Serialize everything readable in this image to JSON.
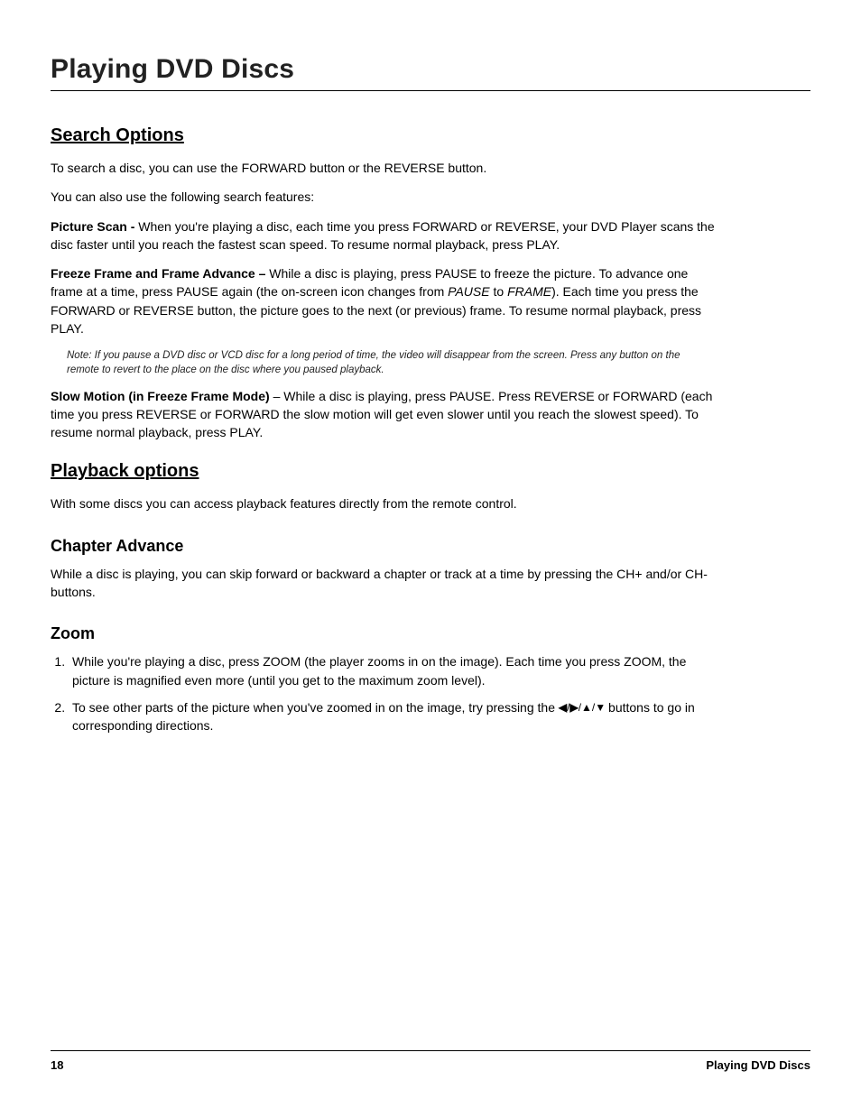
{
  "chapter": {
    "title": "Playing DVD Discs"
  },
  "sections": {
    "search": {
      "heading": "Search Options",
      "intro1": "To search a disc, you can use the FORWARD button or the REVERSE button.",
      "intro2": "You can also use the following search features:",
      "pictureScan": {
        "label": "Picture Scan -",
        "text": " When you're playing a disc, each time you press FORWARD or REVERSE, your DVD Player scans the disc faster until you reach the fastest scan speed. To resume normal playback, press PLAY."
      },
      "freezeFrame": {
        "label": "Freeze Frame and Frame Advance –",
        "pre": " While a disc is playing, press PAUSE to freeze the picture. To advance one frame at a time, press PAUSE again (the on-screen icon changes from ",
        "pauseWord": "PAUSE",
        "mid": " to ",
        "frameWord": "FRAME",
        "post": "). Each time you press the FORWARD or REVERSE button, the picture goes to the next (or previous) frame. To resume normal playback, press PLAY."
      },
      "note": "Note: If you pause a DVD disc or VCD disc for a long period of time, the video will disappear from the screen. Press any button on the remote to revert to the place on the disc where you paused playback.",
      "slowMotion": {
        "label": "Slow Motion (in Freeze Frame Mode)",
        "text": " – While a disc is playing, press PAUSE. Press REVERSE or FORWARD (each time you press REVERSE or FORWARD the slow motion will get even slower until you reach the slowest speed). To resume normal playback, press PLAY."
      }
    },
    "playback": {
      "heading": "Playback options",
      "text": "With some discs you can access playback features directly from the remote control."
    },
    "chapterAdvance": {
      "heading": "Chapter Advance",
      "text": "While a disc is playing, you can skip forward or backward a chapter or track at a time by pressing the CH+ and/or CH- buttons."
    },
    "zoom": {
      "heading": "Zoom",
      "step1": "While you're playing a disc, press ZOOM (the player zooms in on the image). Each time you press ZOOM, the picture is magnified even more (until you get to the maximum zoom level).",
      "step2_pre": "To see other parts of the picture when you've zoomed in on the image, try pressing the ",
      "step2_post": " buttons to go in corresponding directions."
    }
  },
  "icons": {
    "arrows": {
      "left": "◀",
      "right": "▶",
      "up": "▲",
      "down": "▼",
      "sep": "/"
    }
  },
  "footer": {
    "pageNumber": "18",
    "sectionLabel": "Playing DVD Discs"
  }
}
